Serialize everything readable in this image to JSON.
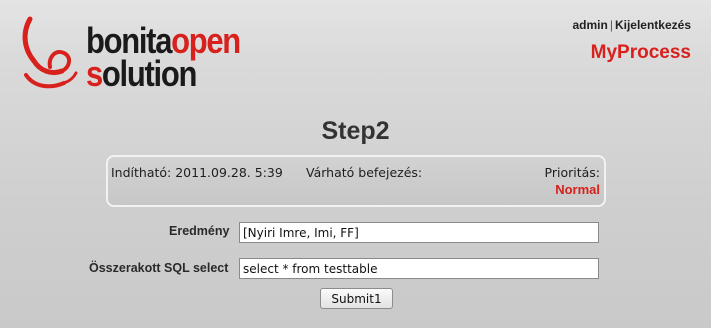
{
  "header": {
    "logo_text_dark_1": "bonita",
    "logo_text_red_1": "open",
    "logo_text_red_2": "s",
    "logo_text_dark_2": "olution",
    "logo_icon": "bonita-logo-icon",
    "user_name": "admin",
    "separator": "|",
    "logout_label": "Kijelentkezés",
    "process_name": "MyProcess"
  },
  "step": {
    "title": "Step2",
    "startable": "Indítható: 2011.09.28. 5:39",
    "expected_end_label": "Várható befejezés:",
    "priority_label": "Prioritás:",
    "priority_value": "Normal"
  },
  "form": {
    "result_label": "Eredmény",
    "result_value": "[Nyiri Imre, Imi, FF]",
    "sql_label": "Összerakott SQL select",
    "sql_value": "select * from testtable",
    "submit_label": "Submit1"
  },
  "colors": {
    "accent": "#d8201c",
    "background": "#d2d2d2"
  }
}
